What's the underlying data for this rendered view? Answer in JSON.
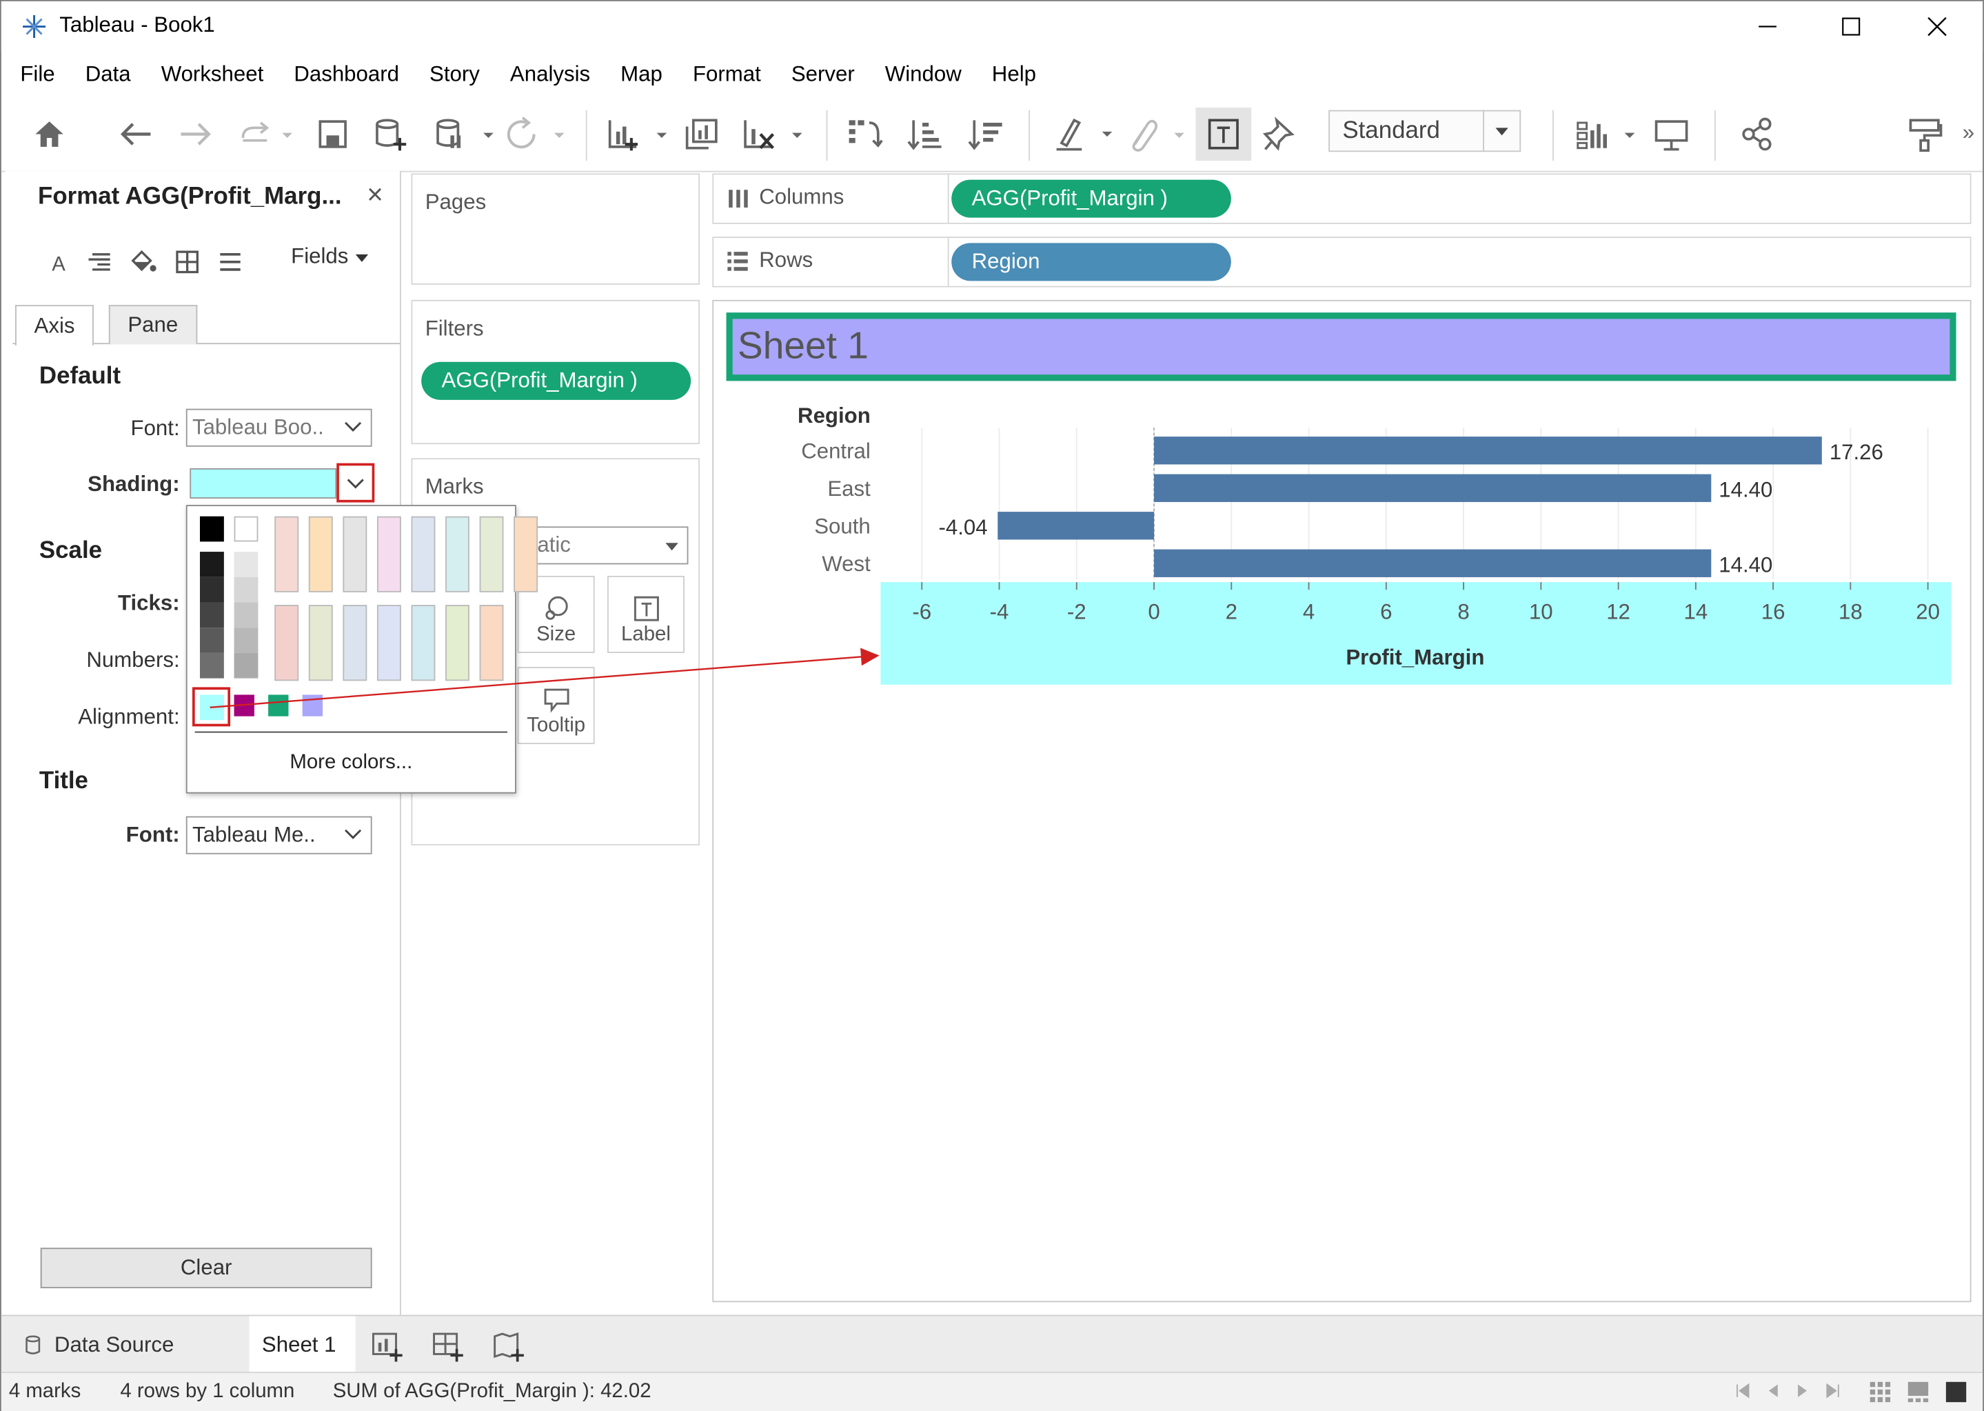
{
  "window": {
    "title": "Tableau - Book1",
    "minimize": "—",
    "maximize": "☐",
    "close": "✕"
  },
  "menu": [
    "File",
    "Data",
    "Worksheet",
    "Dashboard",
    "Story",
    "Analysis",
    "Map",
    "Format",
    "Server",
    "Window",
    "Help"
  ],
  "toolbar": {
    "fit_select": "Standard",
    "icons": [
      "home-icon",
      "undo-icon",
      "redo-icon",
      "replay-icon",
      "save-icon",
      "new-data-source-icon",
      "pause-updates-icon",
      "refresh-icon",
      "new-worksheet-icon",
      "duplicate-sheet-icon",
      "clear-sheet-icon",
      "swap-icon",
      "sort-ascending-icon",
      "sort-descending-icon",
      "highlight-icon",
      "group-icon",
      "show-labels-icon",
      "pin-icon",
      "show-me-icon",
      "presentation-icon",
      "share-icon",
      "format-painter-icon"
    ]
  },
  "format_pane": {
    "title": "Format AGG(Profit_Marg...",
    "close": "×",
    "fields_label": "Fields",
    "tabs": [
      "Axis",
      "Pane"
    ],
    "active_tab": "Axis",
    "default_section": "Default",
    "font_label": "Font:",
    "font_value": "Tableau Boo..",
    "shading_label": "Shading:",
    "shading_color": "#a9fefe",
    "scale_section": "Scale",
    "ticks_label": "Ticks:",
    "numbers_label": "Numbers:",
    "alignment_label": "Alignment:",
    "title_section": "Title",
    "title_font_label": "Font:",
    "title_font_value": "Tableau Me..",
    "clear_label": "Clear"
  },
  "color_popup": {
    "more_colors": "More colors...",
    "recent_colors": [
      "#a9fefe",
      "#a3007c",
      "#17a575",
      "#a9a6fb"
    ],
    "selected": "#a9fefe"
  },
  "pages_card": {
    "title": "Pages"
  },
  "filters_card": {
    "title": "Filters",
    "pill": "AGG(Profit_Margin )"
  },
  "marks_card": {
    "title": "Marks",
    "type_value": "omatic",
    "buttons": [
      "Size",
      "Label",
      "Tooltip"
    ]
  },
  "columns_shelf": {
    "label": "Columns",
    "pill": "AGG(Profit_Margin )"
  },
  "rows_shelf": {
    "label": "Rows",
    "pill": "Region"
  },
  "view": {
    "sheet_title": "Sheet 1",
    "row_header": "Region",
    "title_fill": "#a9a6fb",
    "title_border": "#17a575",
    "bar_color": "#4e79a7"
  },
  "chart_data": {
    "type": "bar",
    "orientation": "horizontal",
    "categories": [
      "Central",
      "East",
      "South",
      "West"
    ],
    "values": [
      17.26,
      14.4,
      -4.04,
      14.4
    ],
    "data_labels": [
      "17.26",
      "14.40",
      "-4.04",
      "14.40"
    ],
    "xlabel": "Profit_Margin",
    "ylabel": "Region",
    "xlim": [
      -7,
      20.5
    ],
    "ticks": [
      -6,
      -4,
      -2,
      0,
      2,
      4,
      6,
      8,
      10,
      12,
      14,
      16,
      18,
      20
    ],
    "tick_labels": [
      "-6",
      "-4",
      "-2",
      "0",
      "2",
      "4",
      "6",
      "8",
      "10",
      "12",
      "14",
      "16",
      "18",
      "20"
    ],
    "grid": true,
    "axis_shading": "#a9fefe"
  },
  "sheet_tabs": {
    "data_source": "Data Source",
    "active": "Sheet 1"
  },
  "status": {
    "marks": "4 marks",
    "rows_cols": "4 rows by 1 column",
    "sum": "SUM of AGG(Profit_Margin ): 42.02"
  }
}
